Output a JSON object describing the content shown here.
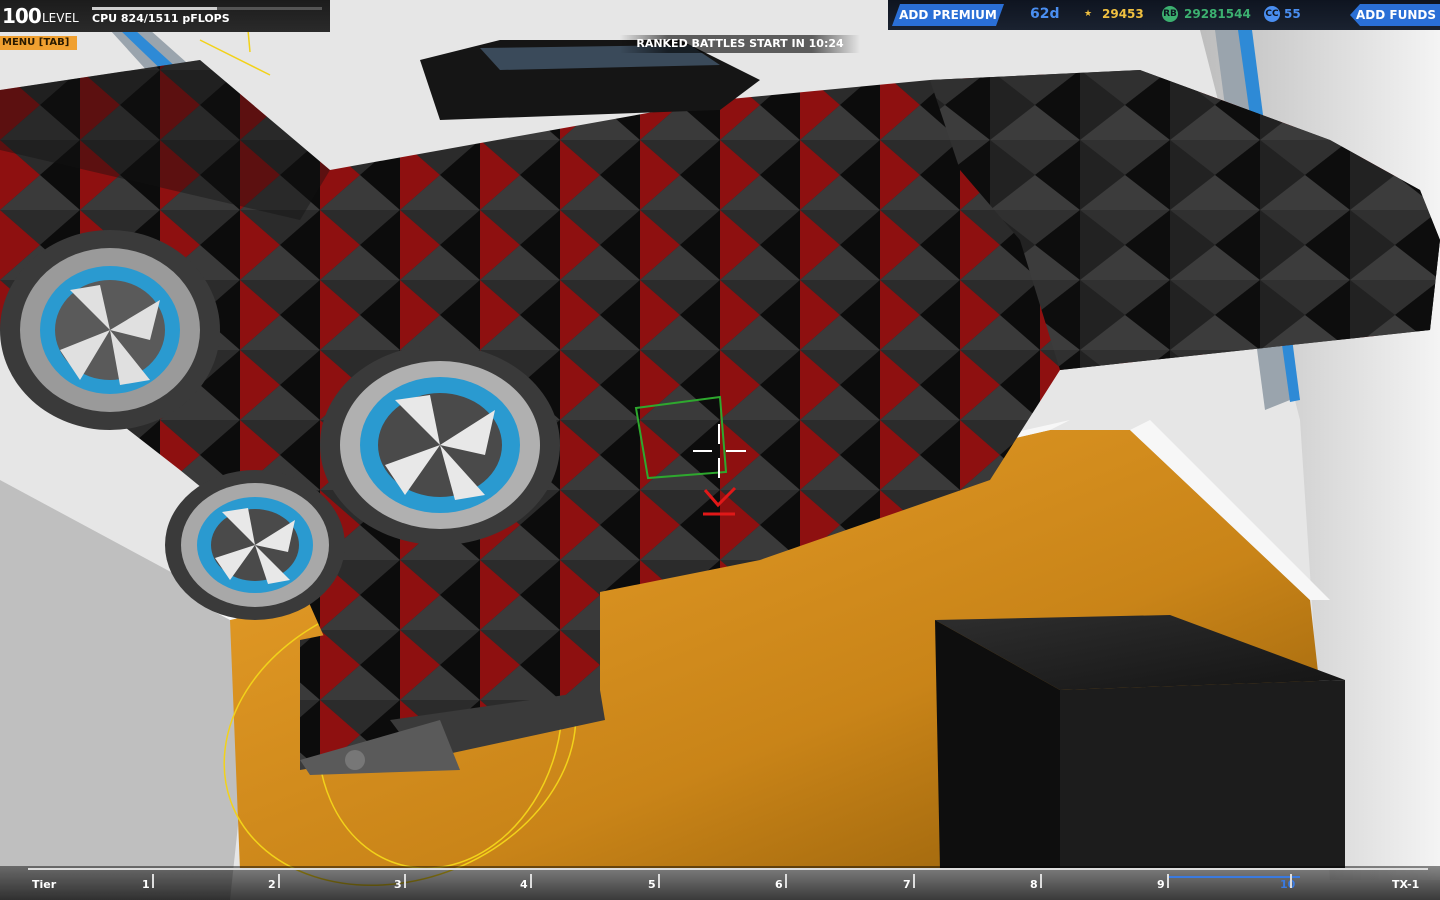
{
  "hud": {
    "level_value": "100",
    "level_label": "LEVEL",
    "cpu_text": "CPU 824/1511 pFLOPS",
    "cpu_used": 824,
    "cpu_max": 1511,
    "menu_label": "MENU [TAB]",
    "ranked_text": "RANKED BATTLES START IN 10:24"
  },
  "currencies": {
    "premium_button": "ADD PREMIUM",
    "premium_days": "62d",
    "tech_points": "29453",
    "robits": "29281544",
    "cosmetic_credits": "55",
    "funds_button": "ADD FUNDS",
    "robits_icon_text": "RB",
    "cc_icon_text": "CC",
    "colors": {
      "tech_points": "#f0c040",
      "robits": "#3cb070",
      "cosmetic_credits": "#4a8ef0",
      "button": "#2a6fd6"
    }
  },
  "tiers": {
    "labels": [
      "Tier",
      "1",
      "2",
      "3",
      "4",
      "5",
      "6",
      "7",
      "8",
      "9",
      "10",
      "TX-1"
    ],
    "current": "10"
  },
  "scene": {
    "block_color": "#1c1c1c",
    "accent_color": "#c01818",
    "floor_color": "#e8a030"
  }
}
